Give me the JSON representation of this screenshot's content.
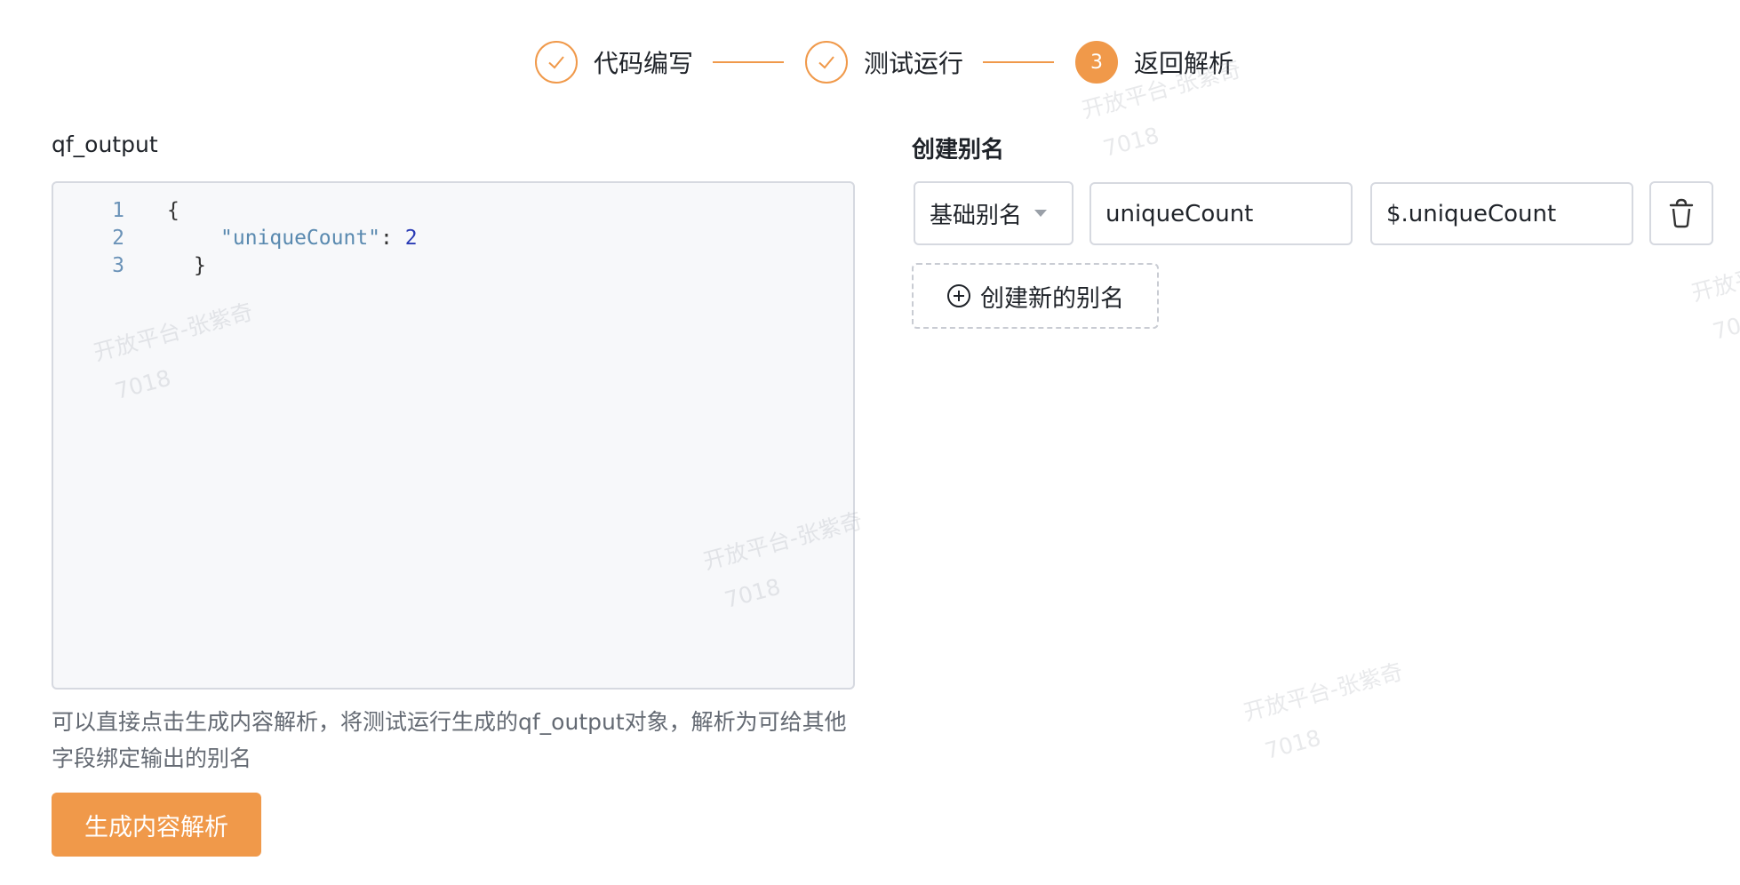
{
  "steps": [
    {
      "label": "代码编写",
      "state": "done"
    },
    {
      "label": "测试运行",
      "state": "done"
    },
    {
      "label": "返回解析",
      "state": "active",
      "number": "3"
    }
  ],
  "left": {
    "title": "qf_output",
    "code_lines": [
      {
        "no": "1",
        "text": "{"
      },
      {
        "no": "2",
        "key": "\"uniqueCount\"",
        "sep": ": ",
        "value": "2"
      },
      {
        "no": "3",
        "text": "}"
      }
    ],
    "hint": "可以直接点击生成内容解析，将测试运行生成的qf_output对象，解析为可给其他字段绑定输出的别名",
    "generate_label": "生成内容解析"
  },
  "right": {
    "title": "创建别名",
    "alias_type": "基础别名",
    "alias_name": "uniqueCount",
    "alias_path": "$.uniqueCount",
    "add_label": "创建新的别名"
  },
  "watermark": {
    "line1": "开放平台-张紫奇",
    "line2": "7018"
  },
  "colors": {
    "accent": "#f0994a",
    "border": "#d6d9e0",
    "editor_bg": "#f7f8fa"
  }
}
